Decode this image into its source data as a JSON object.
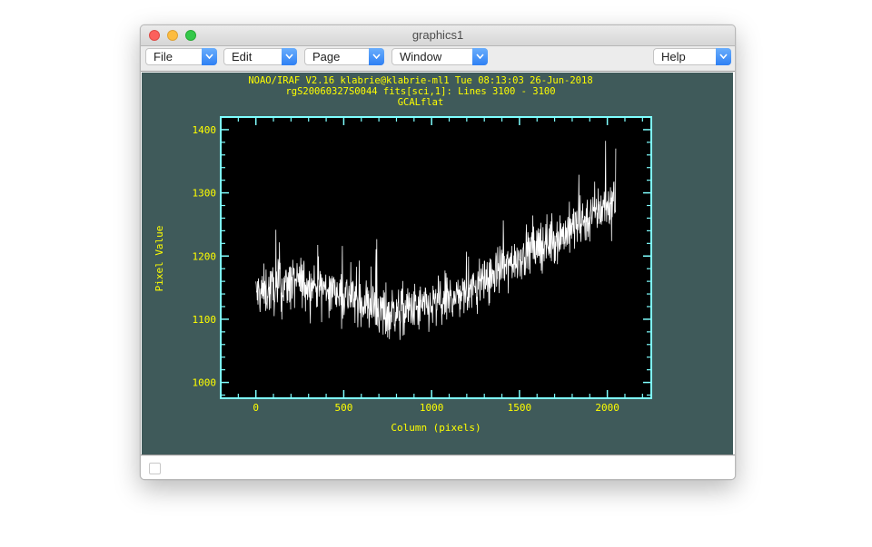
{
  "window": {
    "title": "graphics1"
  },
  "menubar": {
    "file": "File",
    "edit": "Edit",
    "page": "Page",
    "window": "Window",
    "help": "Help"
  },
  "colors": {
    "plot_background": "#3f5a5a",
    "axes_frame": "#7fffff",
    "text": "#ffff00",
    "data": "#ffffff"
  },
  "chart_data": {
    "type": "line",
    "header_lines": [
      "NOAO/IRAF V2.16 klabrie@klabrie-ml1 Tue 08:13:03 26-Jun-2018",
      "rgS20060327S0044 fits[sci,1]: Lines 3100 - 3100",
      "GCALflat"
    ],
    "xlabel": "Column (pixels)",
    "ylabel": "Pixel Value",
    "xlim": [
      -200,
      2250
    ],
    "ylim": [
      975,
      1420
    ],
    "xticks": [
      "0",
      "500",
      "1000",
      "1500",
      "2000"
    ],
    "yticks": [
      "1000",
      "1100",
      "1200",
      "1300",
      "1400"
    ],
    "grid": false,
    "x_start": 0,
    "x_end": 2048,
    "trend_points": [
      {
        "x": 0,
        "y": 1140
      },
      {
        "x": 250,
        "y": 1160
      },
      {
        "x": 500,
        "y": 1140
      },
      {
        "x": 750,
        "y": 1110
      },
      {
        "x": 1000,
        "y": 1120
      },
      {
        "x": 1250,
        "y": 1150
      },
      {
        "x": 1500,
        "y": 1200
      },
      {
        "x": 1750,
        "y": 1235
      },
      {
        "x": 2048,
        "y": 1290
      }
    ]
  }
}
